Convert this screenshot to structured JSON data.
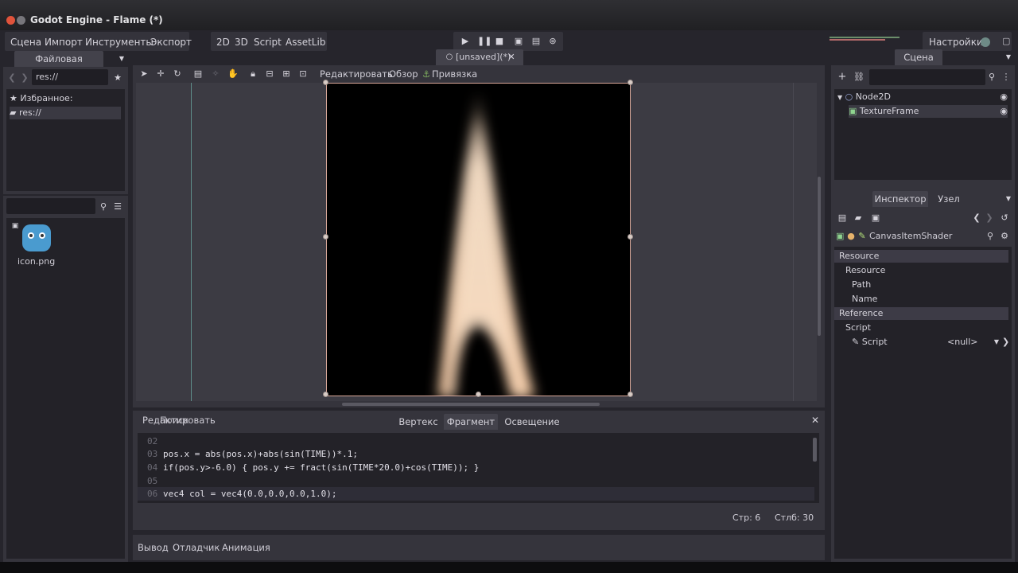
{
  "window": {
    "title": "Godot Engine - Flame (*)"
  },
  "menu": {
    "items": [
      "Сцена",
      "Импорт",
      "Инструменты",
      "Экспорт"
    ],
    "modes": [
      "2D",
      "3D",
      "Script",
      "AssetLib"
    ],
    "settings_label": "Настройки"
  },
  "playback_icons": [
    "play-icon",
    "pause-icon",
    "stop-icon",
    "play-scene-icon",
    "play-custom-icon",
    "debug-icon"
  ],
  "filesystem": {
    "tab_label": "Файловая система",
    "path": "res://",
    "tree": [
      "Избранное:",
      "res://"
    ],
    "file_name": "icon.png"
  },
  "editor_tab": {
    "label": "[unsaved](*)"
  },
  "canvas_toolbar": {
    "edit_label": "Редактировать",
    "view_label": "Обзор",
    "snap_label": "Привязка"
  },
  "scene_panel": {
    "tab_label": "Сцена",
    "nodes": [
      "Node2D",
      "TextureFrame"
    ]
  },
  "inspector": {
    "tabs": [
      "Инспектор",
      "Узел"
    ],
    "resource_type": "CanvasItemShader",
    "sections": [
      "Resource",
      "Reference"
    ],
    "resource_rows": [
      "Resource",
      "Path",
      "Name"
    ],
    "script_group": "Script",
    "script_label": "Script",
    "script_value": "<null>"
  },
  "shader_editor": {
    "header_label_a": "Редактировать",
    "header_label_b": "Поиск",
    "tabs": [
      "Вертекс",
      "Фрагмент",
      "Освещение"
    ],
    "lines": [
      {
        "num": "02",
        "code": ""
      },
      {
        "num": "03",
        "code": "pos.x = abs(pos.x)+abs(sin(TIME))*.1;"
      },
      {
        "num": "04",
        "code": "if(pos.y>-6.0) { pos.y += fract(sin(TIME*20.0)+cos(TIME)); }"
      },
      {
        "num": "05",
        "code": ""
      },
      {
        "num": "06",
        "code": "vec4 col = vec4(0.0,0.0,0.0,1.0);"
      }
    ],
    "status_line": "Стр: 6",
    "status_col": "Стлб: 30"
  },
  "bottom_panel": {
    "tabs": [
      "Вывод",
      "Отладчик",
      "Анимация"
    ]
  },
  "colors": {
    "accent": "#6d8ae0",
    "background": "#26252c",
    "panel": "#35343c",
    "selection_border": "#d9a89a"
  }
}
